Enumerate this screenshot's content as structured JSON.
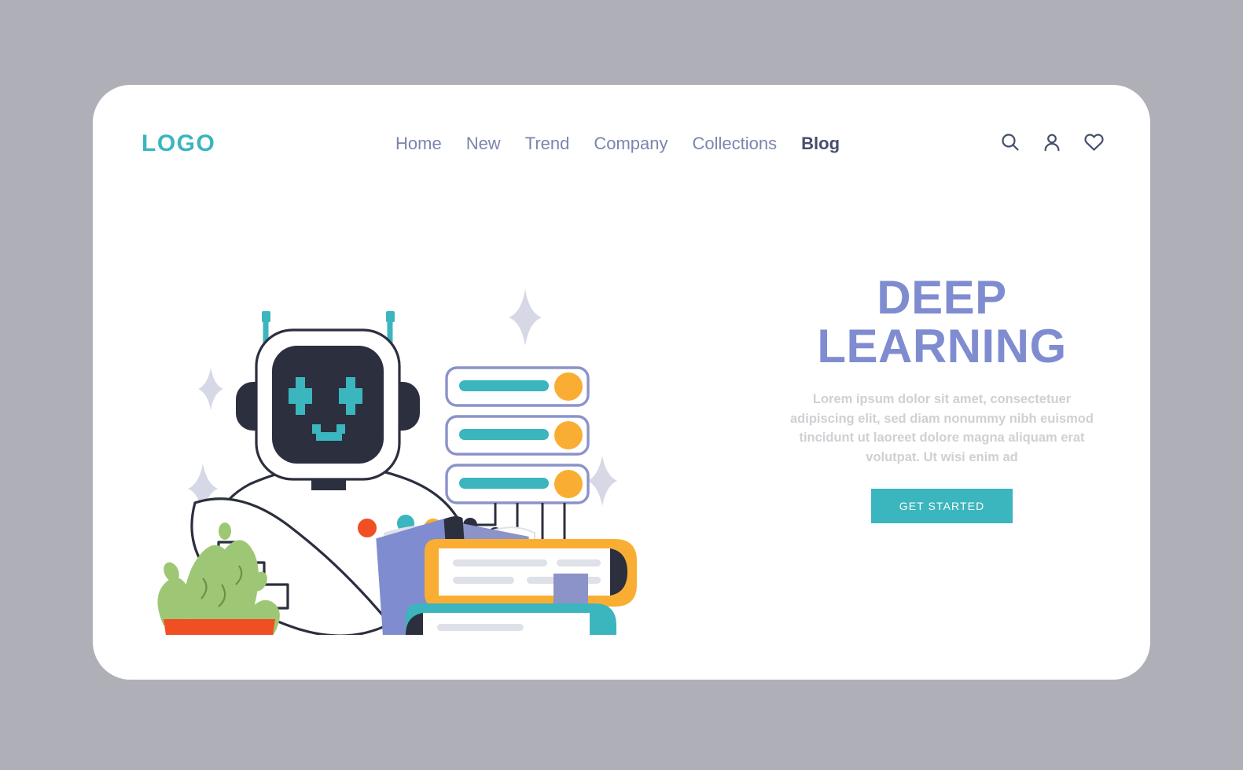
{
  "page": {
    "background_color": "#afafb8",
    "card_color": "#ffffff"
  },
  "header": {
    "logo": "LOGO",
    "logo_color": "#3bb5be",
    "nav": [
      {
        "label": "Home",
        "active": false
      },
      {
        "label": "New",
        "active": false
      },
      {
        "label": "Trend",
        "active": false
      },
      {
        "label": "Company",
        "active": false
      },
      {
        "label": "Collections",
        "active": false
      },
      {
        "label": "Blog",
        "active": true
      }
    ],
    "icons": [
      {
        "name": "search-icon",
        "glyph": "search"
      },
      {
        "name": "user-icon",
        "glyph": "user"
      },
      {
        "name": "heart-icon",
        "glyph": "heart"
      }
    ],
    "icon_color": "#454e6b"
  },
  "hero": {
    "title_line1": "DEEP",
    "title_line2": "LEARNING",
    "title_color": "#7f8cd0",
    "paragraph": "Lorem ipsum dolor sit amet, consectetuer adipiscing elit, sed diam nonummy nibh euismod tincidunt ut laoreet dolore magna aliquam erat volutpat. Ut wisi enim ad",
    "paragraph_color": "#cfd0d4",
    "cta_label": "GET STARTED",
    "cta_color": "#3bb5be",
    "cta_text_color": "#ffffff"
  },
  "illustration": {
    "description": "Robot reading an open book beside a cactus, server racks, circuit nodes and a stack of books",
    "palette": {
      "teal": "#3bb5be",
      "dark_navy": "#2b2f3e",
      "periwinkle": "#7f8cd0",
      "light_periwinkle": "#8b93c9",
      "orange": "#f9ae33",
      "red_orange": "#f04e23",
      "green": "#9ec775",
      "light_gray": "#dfe1e8",
      "sparkle": "#d6d8e6",
      "ground_line": "#4a5066"
    },
    "robot": {
      "eye_shape": "pixel-cross",
      "mouth_shape": "pixel-smile",
      "antenna_count": 2
    },
    "servers": {
      "count": 3,
      "bar_color": "#3bb5be",
      "dot_color": "#f9ae33",
      "outline_color": "#8b93c9"
    },
    "books_stack": [
      {
        "cover_color": "#f9ae33",
        "has_bookmark": true
      },
      {
        "cover_color": "#3bb5be",
        "has_bookmark": false
      }
    ],
    "open_book": {
      "cover_color": "#7f8cd0",
      "spine_color": "#2b2f3e"
    },
    "plant": {
      "pot_color": "#f04e23",
      "leaf_color": "#9ec775"
    },
    "floating_dots": [
      {
        "color": "#f04e23"
      },
      {
        "color": "#3bb5be"
      },
      {
        "color": "#f9ae33"
      }
    ],
    "sparkles": 4,
    "ground_lines": 3
  }
}
